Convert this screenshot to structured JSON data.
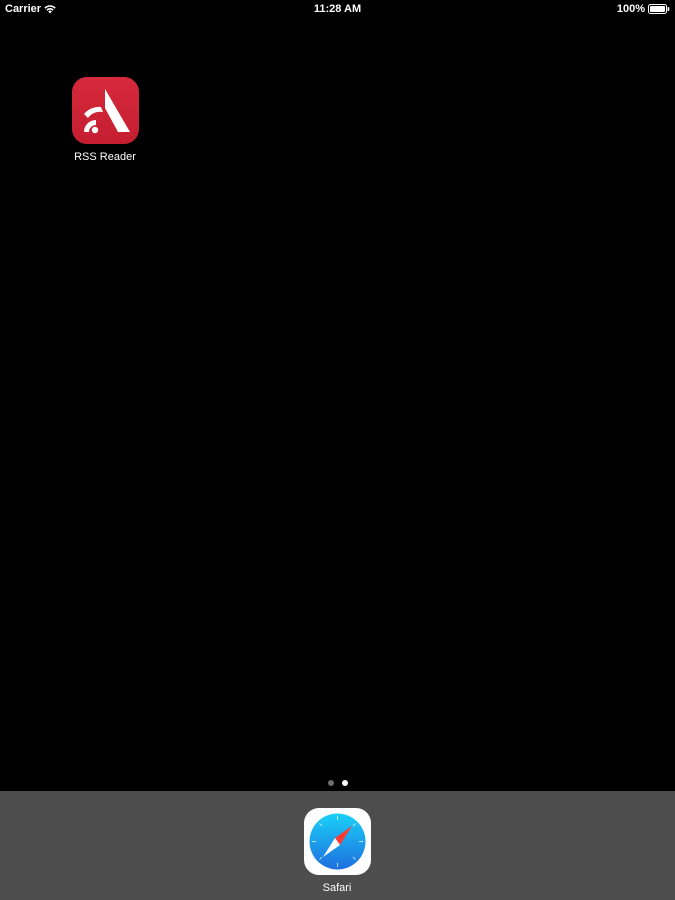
{
  "status_bar": {
    "carrier": "Carrier",
    "time": "11:28 AM",
    "battery_percent": "100%",
    "icons": [
      "wifi-icon",
      "battery-icon"
    ]
  },
  "home_screen": {
    "apps": [
      {
        "label": "RSS Reader",
        "icon": "rss-reader-app-icon",
        "color": "#d0233a"
      }
    ],
    "page_indicator": {
      "pages": 2,
      "current_page": 2
    }
  },
  "dock": {
    "apps": [
      {
        "label": "Safari",
        "icon": "safari-app-icon"
      }
    ]
  },
  "colors": {
    "background": "#000000",
    "dock": "#4d4d4d",
    "rss_accent": "#d0233a",
    "safari_blue": "#1e88e5"
  }
}
